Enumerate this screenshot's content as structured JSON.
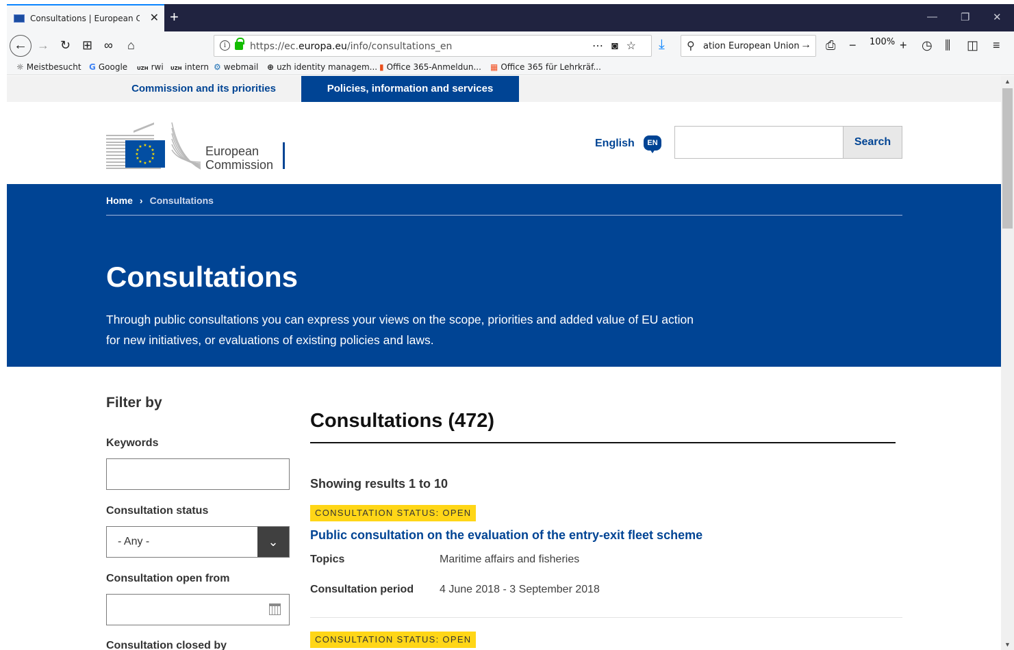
{
  "browser": {
    "tab_title": "Consultations | European Comm",
    "url_prefix": "https://ec.",
    "url_domain": "europa.eu",
    "url_path": "/info/consultations_en",
    "search_text": "ation European Union",
    "zoom": "100%",
    "bookmarks": [
      {
        "icon": "☼",
        "label": "Meistbesucht"
      },
      {
        "icon": "G",
        "label": "Google"
      },
      {
        "icon": "UZH",
        "label": "rwi"
      },
      {
        "icon": "UZH",
        "label": "intern"
      },
      {
        "icon": "⚙",
        "label": "webmail"
      },
      {
        "icon": "⊕",
        "label": "uzh identity managem..."
      },
      {
        "icon": "▮",
        "label": "Office 365-Anmeldun..."
      },
      {
        "icon": "▦",
        "label": "Office 365 für Lehrkräf..."
      }
    ]
  },
  "topnav": {
    "item1": "Commission and its priorities",
    "item2": "Policies, information and services"
  },
  "header": {
    "logo_line1": "European",
    "logo_line2": "Commission",
    "language": "English",
    "language_code": "EN",
    "search_button": "Search"
  },
  "hero": {
    "breadcrumb_home": "Home",
    "breadcrumb_sep": "›",
    "breadcrumb_current": "Consultations",
    "title": "Consultations",
    "description": "Through public consultations you can express your views on the scope, priorities and added value of EU action for new initiatives, or evaluations of existing policies and laws."
  },
  "filters": {
    "title": "Filter by",
    "keywords_label": "Keywords",
    "status_label": "Consultation status",
    "status_value": "- Any -",
    "open_from_label": "Consultation open from",
    "closed_by_label": "Consultation closed by"
  },
  "results": {
    "title": "Consultations (472)",
    "showing": "Showing results 1 to 10",
    "items": [
      {
        "status": "CONSULTATION STATUS: OPEN",
        "title": "Public consultation on the evaluation of the entry-exit fleet scheme",
        "topics_label": "Topics",
        "topics": "Maritime affairs and fisheries",
        "period_label": "Consultation period",
        "period": "4 June 2018 - 3 September 2018"
      },
      {
        "status": "CONSULTATION STATUS: OPEN"
      }
    ]
  },
  "colors": {
    "ec_blue": "#004494",
    "status_yellow": "#ffd617",
    "browser_dark": "#202340"
  }
}
